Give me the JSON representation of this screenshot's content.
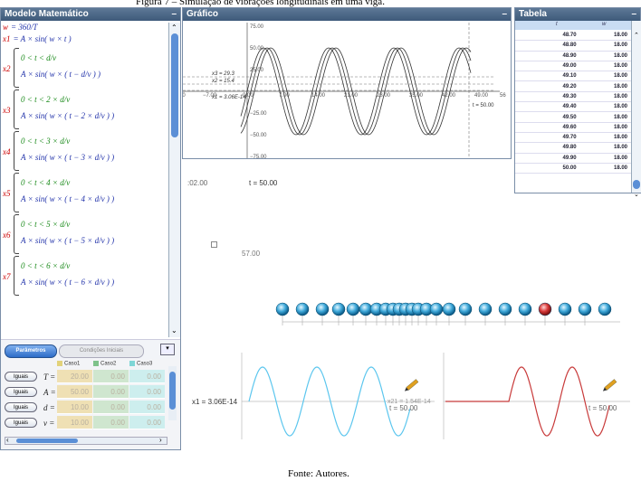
{
  "caption_top": "Figura 7 – Simulação de vibrações longitudinais em uma viga.",
  "caption_bottom": "Fonte: Autores.",
  "model_panel": {
    "title": "Modelo Matemático",
    "lines": [
      {
        "var": "w",
        "expr": "= 360/T"
      },
      {
        "var": "x1",
        "expr": "= A × sin( w × t )"
      },
      {
        "var": "x2",
        "cond": "0 < t < d/v",
        "expr": "A × sin( w × ( t − d/v ) )"
      },
      {
        "var": "x3",
        "cond": "0 < t < 2 × d/v",
        "expr": "A × sin( w × ( t − 2 × d/v ) )"
      },
      {
        "var": "x4",
        "cond": "0 < t < 3 × d/v",
        "expr": "A × sin( w × ( t − 3 × d/v ) )"
      },
      {
        "var": "x5",
        "cond": "0 < t < 4 × d/v",
        "expr": "A × sin( w × ( t − 4 × d/v ) )"
      },
      {
        "var": "x6",
        "cond": "0 < t < 5 × d/v",
        "expr": "A × sin( w × ( t − 5 × d/v ) )"
      },
      {
        "var": "x7",
        "cond": "0 < t < 6 × d/v",
        "expr": "A × sin( w × ( t − 6 × d/v ) )"
      }
    ]
  },
  "tabs": {
    "params": "Parâmetros",
    "initial": "Condições Iniciais"
  },
  "params": {
    "cases": [
      "Caso1",
      "Caso2",
      "Caso3"
    ],
    "case_colors": [
      "#e2d27a",
      "#7ec28a",
      "#7fd6d6"
    ],
    "rows": [
      {
        "button": "Iguais",
        "label": "T =",
        "values": [
          "20.00",
          "0.00",
          "0.00"
        ]
      },
      {
        "button": "Iguais",
        "label": "A =",
        "values": [
          "50.00",
          "0.00",
          "0.00"
        ]
      },
      {
        "button": "Iguais",
        "label": "d =",
        "values": [
          "10.00",
          "0.00",
          "0.00"
        ]
      },
      {
        "button": "Iguais",
        "label": "v =",
        "values": [
          "10.00",
          "0.00",
          "0.00"
        ]
      }
    ]
  },
  "graph_panel": {
    "title": "Gráfico",
    "y_ticks": [
      "75.00",
      "50.00",
      "25.00",
      "−25.00",
      "−50.00",
      "−75.00"
    ],
    "x_ticks": [
      "00",
      "−7.00",
      "0.00",
      "7.00",
      "14.00",
      "21.00",
      "28.00",
      "35.00",
      "42.00",
      "49.00",
      "56"
    ],
    "x3_label": "x3 = 29.3",
    "x2_label": "x2 = 15.4",
    "x1_label": "x1 = 3.06E-14",
    "t_label": "t = 50.00"
  },
  "table_panel": {
    "title": "Tabela",
    "col1": "t",
    "col2": "w",
    "rows": [
      [
        "48.70",
        "18.00"
      ],
      [
        "48.80",
        "18.00"
      ],
      [
        "48.90",
        "18.00"
      ],
      [
        "49.00",
        "18.00"
      ],
      [
        "49.10",
        "18.00"
      ],
      [
        "49.20",
        "18.00"
      ],
      [
        "49.30",
        "18.00"
      ],
      [
        "49.40",
        "18.00"
      ],
      [
        "49.50",
        "18.00"
      ],
      [
        "49.60",
        "18.00"
      ],
      [
        "49.70",
        "18.00"
      ],
      [
        "49.80",
        "18.00"
      ],
      [
        "49.90",
        "18.00"
      ],
      [
        "50.00",
        "18.00"
      ]
    ]
  },
  "animation": {
    "readout1": ":02.00",
    "readout_t": "t = 50.00",
    "readout2": "57.00",
    "left_graph_label": "x1 = 3.06E-14",
    "left_graph_t": "t = 50.00",
    "mid_label": "x21 = 1.54E-14",
    "right_graph_t": "t = 50.00"
  },
  "colors": {
    "accent_blue": "#3a78d8",
    "wave_cyan": "#5bc6ee",
    "wave_red": "#c83a3a",
    "title_bar": "#4a6788"
  }
}
